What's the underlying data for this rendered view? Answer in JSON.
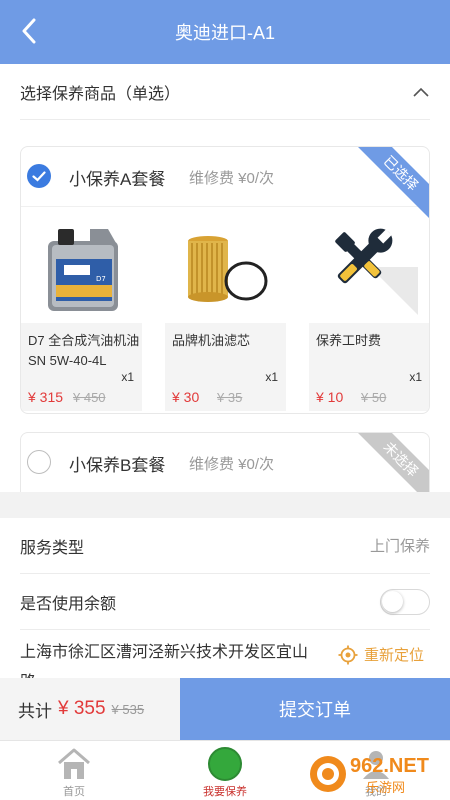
{
  "header": {
    "title": "奥迪进口-A1",
    "back_icon": "back-arrow-icon"
  },
  "selection": {
    "title": "选择保养商品（单选）"
  },
  "packages": [
    {
      "name": "小保养A套餐",
      "fee": "维修费 ¥0/次",
      "status": "已选择",
      "selected": true,
      "items": [
        {
          "name": "D7 全合成汽油机油SN 5W-40-4L",
          "qty": "x1",
          "price": "¥ 315",
          "orig": "¥ 450",
          "icon": "oil-bottle-icon"
        },
        {
          "name": "品牌机油滤芯",
          "qty": "x1",
          "price": "¥ 30",
          "orig": "¥ 35",
          "icon": "oil-filter-icon"
        },
        {
          "name": "保养工时费",
          "qty": "x1",
          "price": "¥ 10",
          "orig": "¥ 50",
          "icon": "tools-icon"
        }
      ]
    },
    {
      "name": "小保养B套餐",
      "fee": "维修费 ¥0/次",
      "status": "未选择",
      "selected": false
    }
  ],
  "service": {
    "label": "服务类型",
    "value": "上门保养"
  },
  "balance": {
    "label": "是否使用余额",
    "enabled": false
  },
  "address": {
    "text": "上海市徐汇区漕河泾新兴技术开发区宜山路",
    "relocate": "重新定位"
  },
  "order": {
    "total_label": "共计",
    "total": "¥ 355",
    "orig_total": "¥ 535",
    "submit": "提交订单"
  },
  "tabs": [
    {
      "label": "首页",
      "icon": "home-icon"
    },
    {
      "label": "我要保养",
      "icon": "maintenance-icon",
      "active": true
    },
    {
      "label": "我的",
      "icon": "user-icon"
    }
  ],
  "watermark": {
    "text": "962.NET",
    "sub": "乐游网"
  },
  "colors": {
    "primary": "#6f9be5",
    "price": "#e23a3a",
    "accent": "#e8a13b",
    "active_green": "#34a83c"
  }
}
